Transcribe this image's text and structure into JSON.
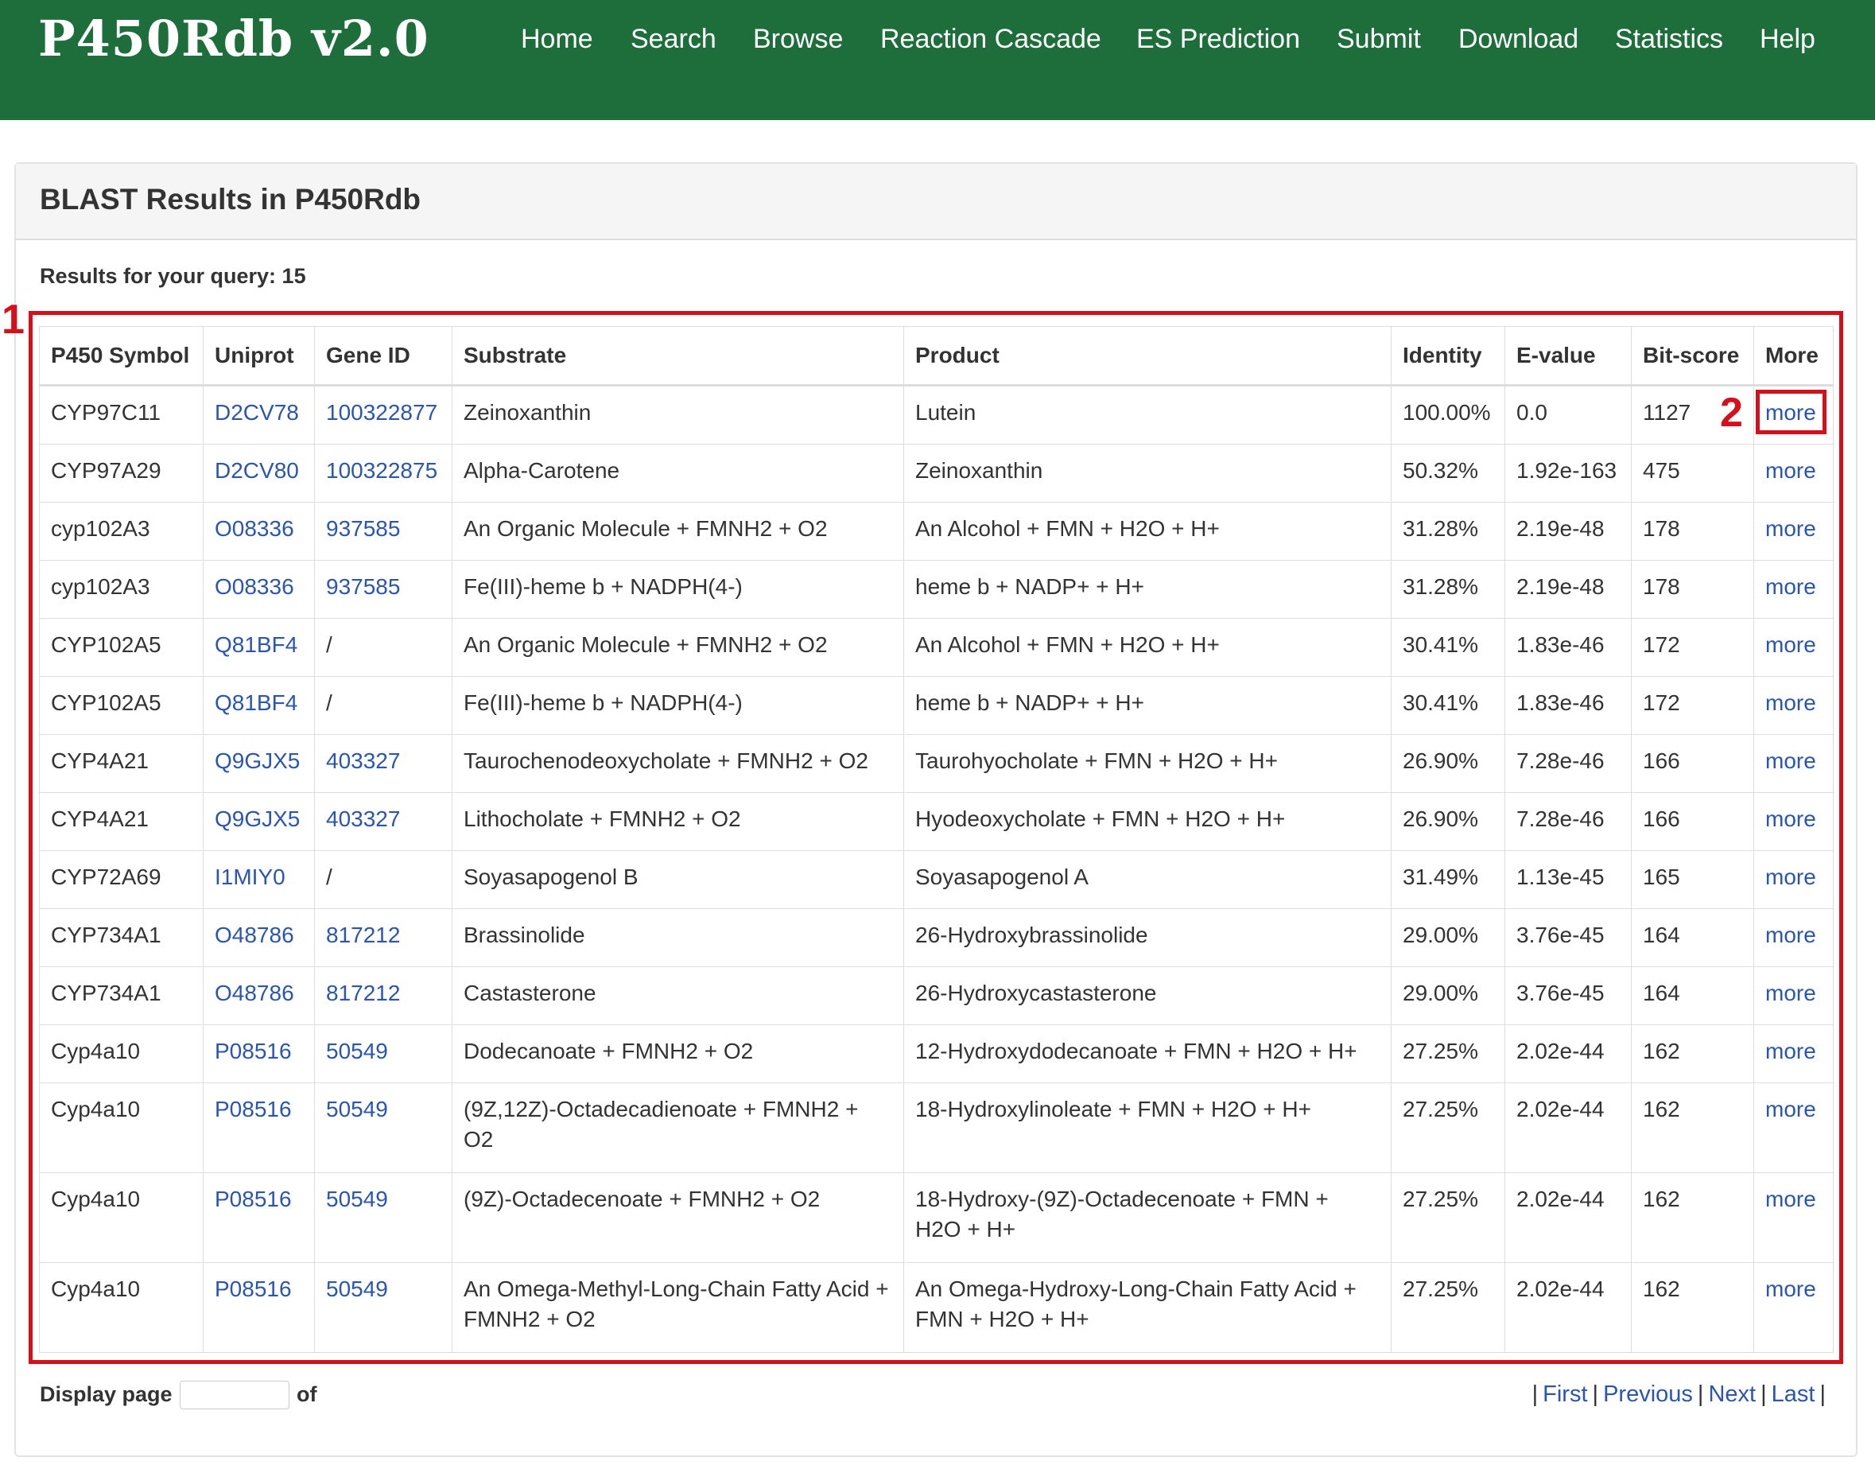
{
  "app": {
    "brand": "P450Rdb v2.0",
    "nav": [
      "Home",
      "Search",
      "Browse",
      "Reaction Cascade",
      "ES Prediction",
      "Submit",
      "Download",
      "Statistics",
      "Help"
    ]
  },
  "panel": {
    "title": "BLAST Results in P450Rdb",
    "results_label": "Results for your query: 15"
  },
  "table": {
    "headers": [
      "P450 Symbol",
      "Uniprot",
      "Gene ID",
      "Substrate",
      "Product",
      "Identity",
      "E-value",
      "Bit-score",
      "More"
    ],
    "rows": [
      {
        "symbol": "CYP97C11",
        "uniprot": "D2CV78",
        "gene_id": "100322877",
        "substrate": "Zeinoxanthin",
        "product": "Lutein",
        "identity": "100.00%",
        "evalue": "0.0",
        "bitscore": "1127",
        "more": "more"
      },
      {
        "symbol": "CYP97A29",
        "uniprot": "D2CV80",
        "gene_id": "100322875",
        "substrate": "Alpha-Carotene",
        "product": "Zeinoxanthin",
        "identity": "50.32%",
        "evalue": "1.92e-163",
        "bitscore": "475",
        "more": "more"
      },
      {
        "symbol": "cyp102A3",
        "uniprot": "O08336",
        "gene_id": "937585",
        "substrate": "An Organic Molecule + FMNH2 + O2",
        "product": "An Alcohol + FMN + H2O + H+",
        "identity": "31.28%",
        "evalue": "2.19e-48",
        "bitscore": "178",
        "more": "more"
      },
      {
        "symbol": "cyp102A3",
        "uniprot": "O08336",
        "gene_id": "937585",
        "substrate": "Fe(III)-heme b + NADPH(4-)",
        "product": "heme b + NADP+ + H+",
        "identity": "31.28%",
        "evalue": "2.19e-48",
        "bitscore": "178",
        "more": "more"
      },
      {
        "symbol": "CYP102A5",
        "uniprot": "Q81BF4",
        "gene_id": "/",
        "substrate": "An Organic Molecule + FMNH2 + O2",
        "product": "An Alcohol + FMN + H2O + H+",
        "identity": "30.41%",
        "evalue": "1.83e-46",
        "bitscore": "172",
        "more": "more"
      },
      {
        "symbol": "CYP102A5",
        "uniprot": "Q81BF4",
        "gene_id": "/",
        "substrate": "Fe(III)-heme b + NADPH(4-)",
        "product": "heme b + NADP+ + H+",
        "identity": "30.41%",
        "evalue": "1.83e-46",
        "bitscore": "172",
        "more": "more"
      },
      {
        "symbol": "CYP4A21",
        "uniprot": "Q9GJX5",
        "gene_id": "403327",
        "substrate": "Taurochenodeoxycholate + FMNH2 + O2",
        "product": "Taurohyocholate + FMN + H2O + H+",
        "identity": "26.90%",
        "evalue": "7.28e-46",
        "bitscore": "166",
        "more": "more"
      },
      {
        "symbol": "CYP4A21",
        "uniprot": "Q9GJX5",
        "gene_id": "403327",
        "substrate": "Lithocholate + FMNH2 + O2",
        "product": "Hyodeoxycholate + FMN + H2O + H+",
        "identity": "26.90%",
        "evalue": "7.28e-46",
        "bitscore": "166",
        "more": "more"
      },
      {
        "symbol": "CYP72A69",
        "uniprot": "I1MIY0",
        "gene_id": "/",
        "substrate": "Soyasapogenol B",
        "product": "Soyasapogenol A",
        "identity": "31.49%",
        "evalue": "1.13e-45",
        "bitscore": "165",
        "more": "more"
      },
      {
        "symbol": "CYP734A1",
        "uniprot": "O48786",
        "gene_id": "817212",
        "substrate": "Brassinolide",
        "product": "26-Hydroxybrassinolide",
        "identity": "29.00%",
        "evalue": "3.76e-45",
        "bitscore": "164",
        "more": "more"
      },
      {
        "symbol": "CYP734A1",
        "uniprot": "O48786",
        "gene_id": "817212",
        "substrate": "Castasterone",
        "product": "26-Hydroxycastasterone",
        "identity": "29.00%",
        "evalue": "3.76e-45",
        "bitscore": "164",
        "more": "more"
      },
      {
        "symbol": "Cyp4a10",
        "uniprot": "P08516",
        "gene_id": "50549",
        "substrate": "Dodecanoate + FMNH2 + O2",
        "product": "12-Hydroxydodecanoate + FMN + H2O + H+",
        "identity": "27.25%",
        "evalue": "2.02e-44",
        "bitscore": "162",
        "more": "more"
      },
      {
        "symbol": "Cyp4a10",
        "uniprot": "P08516",
        "gene_id": "50549",
        "substrate": "(9Z,12Z)-Octadecadienoate + FMNH2 + O2",
        "product": "18-Hydroxylinoleate + FMN + H2O + H+",
        "identity": "27.25%",
        "evalue": "2.02e-44",
        "bitscore": "162",
        "more": "more"
      },
      {
        "symbol": "Cyp4a10",
        "uniprot": "P08516",
        "gene_id": "50549",
        "substrate": "(9Z)-Octadecenoate + FMNH2 + O2",
        "product": "18-Hydroxy-(9Z)-Octadecenoate + FMN + H2O + H+",
        "identity": "27.25%",
        "evalue": "2.02e-44",
        "bitscore": "162",
        "more": "more"
      },
      {
        "symbol": "Cyp4a10",
        "uniprot": "P08516",
        "gene_id": "50549",
        "substrate": "An Omega-Methyl-Long-Chain Fatty Acid + FMNH2 + O2",
        "product": "An Omega-Hydroxy-Long-Chain Fatty Acid + FMN + H2O + H+",
        "identity": "27.25%",
        "evalue": "2.02e-44",
        "bitscore": "162",
        "more": "more"
      }
    ]
  },
  "annotations": {
    "table_marker": "1",
    "more_marker": "2",
    "color": "#d6101b"
  },
  "pagination": {
    "display_label": "Display page",
    "of_label": "of",
    "page_value": "",
    "links": [
      "First",
      "Previous",
      "Next",
      "Last"
    ]
  },
  "colors": {
    "navbar": "#1e6e3b",
    "link": "#2a55b0"
  }
}
